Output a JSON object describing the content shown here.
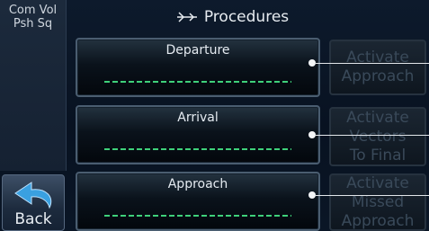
{
  "side": {
    "com_vol_line1": "Com Vol",
    "com_vol_line2": "Psh Sq",
    "back_label": "Back"
  },
  "header": {
    "title": "Procedures",
    "icon": "airplane-icon"
  },
  "procedures": [
    {
      "label": "Departure",
      "value": "-------------------"
    },
    {
      "label": "Arrival",
      "value": "-------------------"
    },
    {
      "label": "Approach",
      "value": "-------------------"
    }
  ],
  "actions": [
    {
      "line1": "Activate",
      "line2": "Approach",
      "line3": ""
    },
    {
      "line1": "Activate",
      "line2": "Vectors",
      "line3": "To Final"
    },
    {
      "line1": "Activate",
      "line2": "Missed",
      "line3": "Approach"
    }
  ],
  "colors": {
    "background": "#0a1626",
    "text": "#e5ebf1",
    "dash_green": "#3fd07a",
    "disabled_text": "#3a4a5a"
  }
}
